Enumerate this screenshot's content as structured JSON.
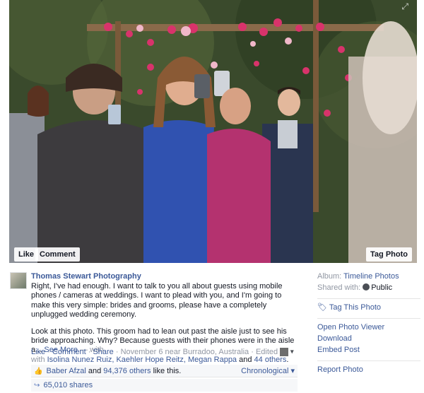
{
  "photo": {
    "like_label": "Like",
    "comment_label": "Comment",
    "tag_label": "Tag Photo"
  },
  "post": {
    "author": "Thomas Stewart Photography",
    "paragraph1": "Right, I've had enough. I want to talk to you all about guests using mobile phones / cameras at weddings. I want to plead with you, and I'm going to make this very simple: brides and grooms, please have a completely unplugged wedding ceremony.",
    "paragraph2": "Look at this photo. This groom had to lean out past the aisle just to see his bride approaching. Why? Because guests with their phones were in the aisle a...",
    "see_more": "See More",
    "with_prefix": "— with",
    "with_names": "Isolina Nunez Ruiz, Kaehler Hope Reitz, Megan Rappa",
    "with_and": "and",
    "with_others": "44 others",
    "like_action": "Like",
    "comment_action": "Comment",
    "share_action": "Share",
    "date_location": "November 6 near Burradoo, Australia",
    "edited": "Edited",
    "likes_name": "Baber Afzal",
    "likes_and": "and",
    "likes_others": "94,376 others",
    "likes_suffix": "like this.",
    "sort_label": "Chronological",
    "shares": "65,010 shares"
  },
  "sidebar": {
    "album_label": "Album:",
    "album_value": "Timeline Photos",
    "shared_label": "Shared with:",
    "shared_value": "Public",
    "tag_photo": "Tag This Photo",
    "open_viewer": "Open Photo Viewer",
    "download": "Download",
    "embed": "Embed Post",
    "report": "Report Photo"
  },
  "colors": {
    "link": "#3b5998",
    "muted": "#9197a3"
  }
}
